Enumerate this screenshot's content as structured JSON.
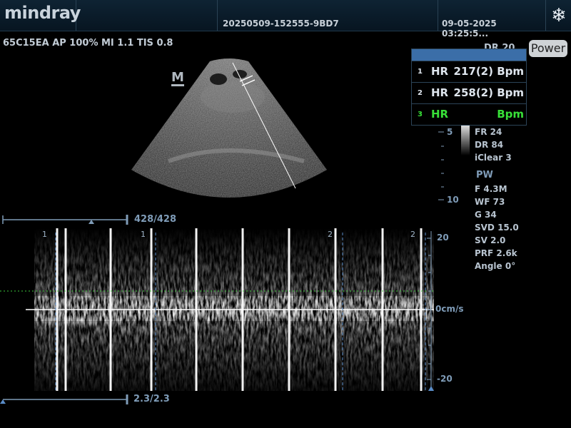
{
  "header": {
    "brand": "mindray",
    "exam_id": "20250509-152555-9BD7",
    "datetime": "09-05-2025 03:25:5...",
    "freeze_icon": "snowflake-icon"
  },
  "probe_info": "65C15EA  AP 100%  MI 1.1  TIS 0.8",
  "orientation_marker": "M",
  "power_button": "Power",
  "dr_label": "DR 20",
  "hr_panel": {
    "rows": [
      {
        "index": "1",
        "label": "HR",
        "value": "217(2) Bpm",
        "color": "#dfe6ee"
      },
      {
        "index": "2",
        "label": "HR",
        "value": "258(2) Bpm",
        "color": "#dfe6ee"
      },
      {
        "index": "3",
        "label": "HR",
        "value": "Bpm",
        "color": "#38e038"
      }
    ]
  },
  "depth_scale": {
    "top": "5",
    "bottom": "10"
  },
  "bmode_params": [
    "FR 24",
    "DR 84",
    "iClear 3"
  ],
  "pw_label": "PW",
  "pw_params": [
    "F 4.3M",
    "WF 73",
    "G 34",
    "SVD 15.0",
    "SV 2.0",
    "PRF 2.6k",
    "Angle 0°"
  ],
  "cine_slider_top": {
    "label": "428/428",
    "position": 1.0
  },
  "cine_slider_bottom": {
    "label": "2.3/2.3",
    "position": 1.0
  },
  "velocity_scale": {
    "top": "20",
    "baseline": "0cm/s",
    "bottom": "-20"
  },
  "cycle_markers": [
    "1",
    "1",
    "2",
    "2"
  ]
}
